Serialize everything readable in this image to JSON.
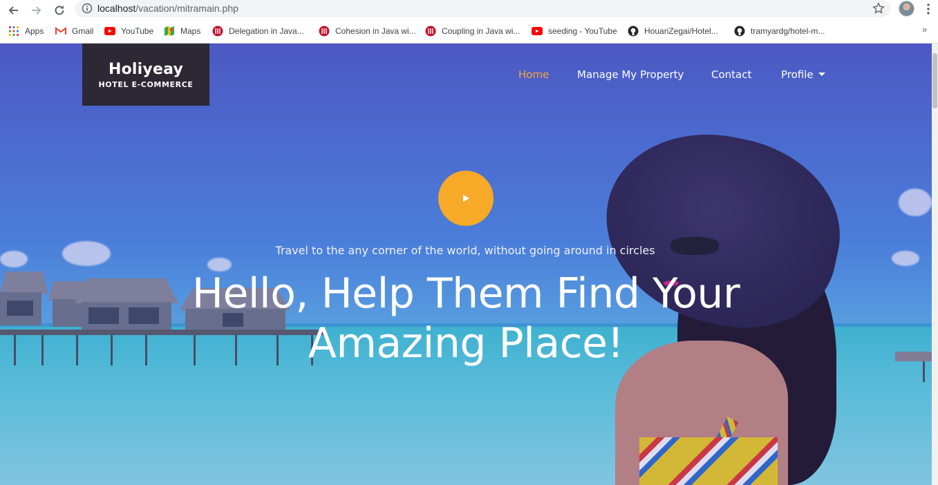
{
  "browser": {
    "url_host": "localhost",
    "url_path": "/vacation/mitramain.php",
    "bookmarks": [
      {
        "label": "Apps",
        "icon": "apps-grid-icon"
      },
      {
        "label": "Gmail",
        "icon": "gmail-icon"
      },
      {
        "label": "YouTube",
        "icon": "youtube-icon"
      },
      {
        "label": "Maps",
        "icon": "maps-icon"
      },
      {
        "label": "Delegation in Java...",
        "icon": "javatpoint-icon"
      },
      {
        "label": "Cohesion in Java wi...",
        "icon": "javatpoint-icon"
      },
      {
        "label": "Coupling in Java wi...",
        "icon": "javatpoint-icon"
      },
      {
        "label": "seeding - YouTube",
        "icon": "youtube-icon"
      },
      {
        "label": "HouariZegai/Hotel...",
        "icon": "github-icon"
      },
      {
        "label": "tramyardg/hotel-m...",
        "icon": "github-icon"
      }
    ],
    "more_label": "»"
  },
  "header": {
    "logo_title": "Holiyeay",
    "logo_subtitle": "HOTEL E-COMMERCE",
    "nav": {
      "home": "Home",
      "manage": "Manage My Property",
      "contact": "Contact",
      "profile": "Profile"
    }
  },
  "hero": {
    "tagline": "Travel to the any corner of the world, without going around in circles",
    "headline_line1": "Hello, Help Them Find Your",
    "headline_line2": "Amazing Place!"
  },
  "colors": {
    "accent": "#f7a928",
    "active_nav": "#f7a63b",
    "logo_bg": "#2c2834"
  }
}
